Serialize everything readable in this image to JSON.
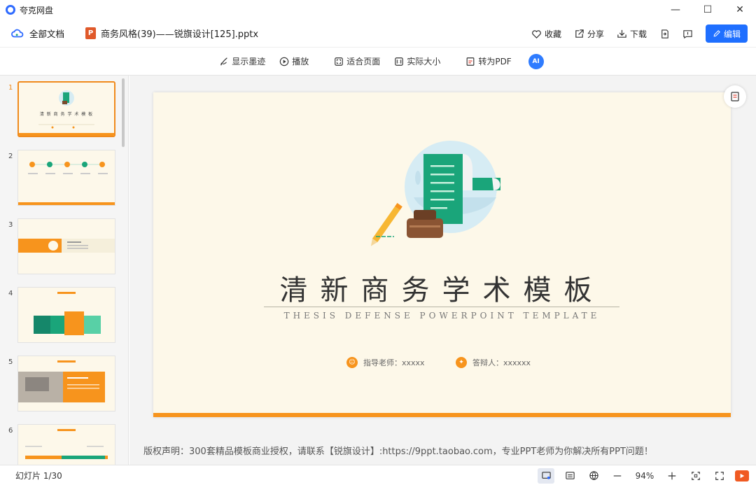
{
  "window": {
    "title": "夸克网盘",
    "minimize": "—",
    "maximize": "☐",
    "close": "✕"
  },
  "header": {
    "all_docs": "全部文档",
    "ppt_badge": "P",
    "filename": "商务风格(39)——锐旗设计[125].pptx",
    "favorite": "收藏",
    "share": "分享",
    "download": "下载",
    "edit": "编辑"
  },
  "toolbar": {
    "ink": "显示墨迹",
    "play": "播放",
    "fit_page": "适合页面",
    "actual_size": "实际大小",
    "to_pdf": "转为PDF",
    "ai": "AI"
  },
  "sidebar": {
    "thumbnails": [
      {
        "num": "1",
        "title": "清 新 商 务 学 术 模 板"
      },
      {
        "num": "2"
      },
      {
        "num": "3"
      },
      {
        "num": "4"
      },
      {
        "num": "5"
      },
      {
        "num": "6"
      }
    ]
  },
  "slide": {
    "title": "清新商务学术模板",
    "subtitle": "THESIS DEFENSE POWERPOINT TEMPLATE",
    "advisor": "指导老师：xxxxx",
    "defender": "答辩人：xxxxxx"
  },
  "copyright": "版权声明：300套精品模板商业授权，请联系【锐旗设计】:https://9ppt.taobao.com，专业PPT老师为你解决所有PPT问题！",
  "status": {
    "slide_count": "幻灯片 1/30",
    "zoom": "94%"
  },
  "colors": {
    "accent": "#1f6fff",
    "orange": "#f7941d",
    "green": "#1aa57a"
  }
}
